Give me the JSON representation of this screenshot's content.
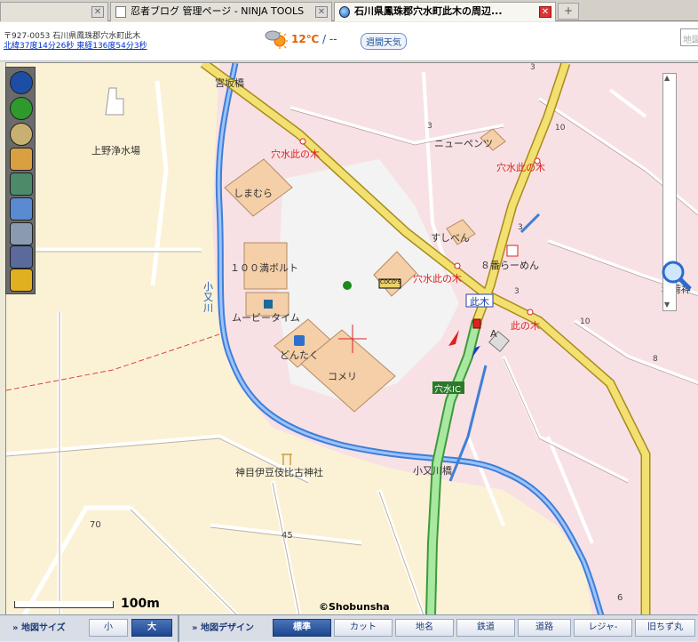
{
  "tabs": [
    {
      "label": "忍者ブログ 管理ページ - NINJA TOOLS",
      "active": false
    },
    {
      "label": "石川県鳳珠郡穴水町此木の周辺...",
      "active": true
    }
  ],
  "info": {
    "address": "〒927-0053  石川県鳳珠郡穴水町此木",
    "coords": "北緯37度14分26秒  東経136度54分3秒",
    "temperature": "12℃",
    "temp_other": "/ --",
    "weekly_button": "週間天気",
    "search_placeholder": "地図"
  },
  "map": {
    "labels": {
      "miyasaka_bridge": "宮坂橋",
      "ueno_water": "上野浄水場",
      "anamizu_konoki_1": "穴水此の木",
      "anamizu_konoki_2": "穴水此の木",
      "anamizu_konoki_3": "穴水此の木",
      "anamizu_konoki_4": "此の木",
      "shimamura": "しまむら",
      "hyakuman_bolt": "１００満ボルト",
      "movie_time": "ムービータイム",
      "dontaku": "どんたく",
      "komeri": "コメリ",
      "new_pents": "ニューペンツ",
      "sushiben": "すしべん",
      "hachiban_ramen": "８番らーめん",
      "konoki_sign": "此木",
      "anamizu_ic": "穴水IC",
      "komata_river": "小又川",
      "komata_bridge": "小又川橋",
      "kamime_shrine": "神目伊豆伎比古神社",
      "inari": "稲荷神",
      "coco": "COCO'S",
      "mark_a": "A",
      "num_3": "3",
      "num_10a": "10",
      "num_10b": "10",
      "num_3b": "3",
      "num_8": "8",
      "num_45": "45",
      "num_70": "70",
      "num_6": "6",
      "num_3c": "3",
      "num_3d": "3"
    },
    "scale": "100m",
    "copyright": "©Shobunsha"
  },
  "toolbar": {
    "size_label": "地図サイズ",
    "size_small": "小",
    "size_large": "大",
    "design_label": "地図デザイン",
    "buttons": [
      "標準",
      "カット",
      "地名",
      "鉄道",
      "道路",
      "レジャ-",
      "旧ちず丸"
    ]
  },
  "colors": {
    "tab_active_bg": "#f7f6f1",
    "accent_blue": "#1d4690",
    "map_pink": "#f8e1e4",
    "map_beige": "#fbf2d6",
    "river_blue": "#3f7fd6",
    "highway_green": "#7ed67a",
    "road_yellow": "#f2e071"
  }
}
